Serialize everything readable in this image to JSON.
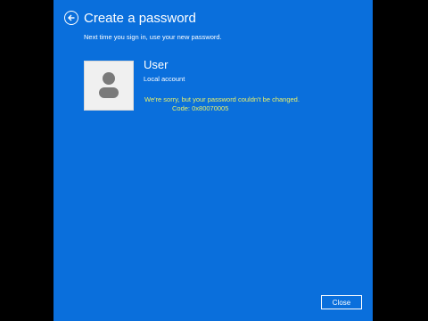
{
  "dialog": {
    "title": "Create a password",
    "subtitle": "Next time you sign in, use your new password."
  },
  "account": {
    "name": "User",
    "type": "Local account"
  },
  "error": {
    "message": "We're sorry, but your password couldn't be changed.",
    "code": "Code: 0x80070005",
    "color": "#e8f06a"
  },
  "buttons": {
    "close_label": "Close",
    "back_icon": "back-arrow-icon"
  },
  "colors": {
    "background": "#0a6fdc",
    "frame": "#000000",
    "text": "#ffffff"
  }
}
